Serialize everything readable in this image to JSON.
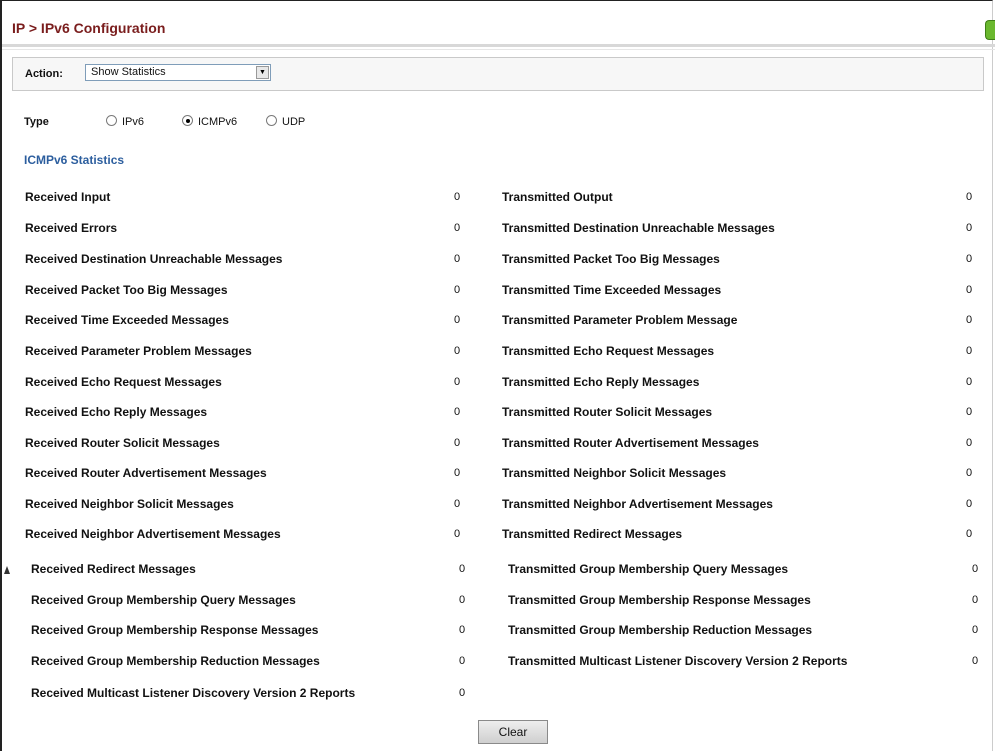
{
  "title": "IP > IPv6 Configuration",
  "action": {
    "label": "Action:",
    "selected": "Show Statistics"
  },
  "type": {
    "label": "Type",
    "options": [
      {
        "label": "IPv6",
        "checked": false
      },
      {
        "label": "ICMPv6",
        "checked": true
      },
      {
        "label": "UDP",
        "checked": false
      }
    ]
  },
  "section_title": "ICMPv6 Statistics",
  "left": [
    {
      "label": "Received Input",
      "value": "0"
    },
    {
      "label": "Received Errors",
      "value": "0"
    },
    {
      "label": "Received Destination Unreachable Messages",
      "value": "0"
    },
    {
      "label": "Received Packet Too Big Messages",
      "value": "0"
    },
    {
      "label": "Received Time Exceeded Messages",
      "value": "0"
    },
    {
      "label": "Received Parameter Problem Messages",
      "value": "0"
    },
    {
      "label": "Received Echo Request Messages",
      "value": "0"
    },
    {
      "label": "Received Echo Reply Messages",
      "value": "0"
    },
    {
      "label": "Received Router Solicit Messages",
      "value": "0"
    },
    {
      "label": "Received Router Advertisement Messages",
      "value": "0"
    },
    {
      "label": "Received Neighbor Solicit Messages",
      "value": "0"
    },
    {
      "label": "Received Neighbor Advertisement Messages",
      "value": "0"
    },
    {
      "label": "Received Redirect Messages",
      "value": "0"
    },
    {
      "label": "Received Group Membership Query Messages",
      "value": "0"
    },
    {
      "label": "Received Group Membership Response Messages",
      "value": "0"
    },
    {
      "label": "Received Group Membership Reduction Messages",
      "value": "0"
    },
    {
      "label": "Received Multicast Listener Discovery Version 2 Reports",
      "value": "0"
    }
  ],
  "right": [
    {
      "label": "Transmitted Output",
      "value": "0"
    },
    {
      "label": "Transmitted Destination Unreachable Messages",
      "value": "0"
    },
    {
      "label": "Transmitted Packet Too Big Messages",
      "value": "0"
    },
    {
      "label": "Transmitted Time Exceeded Messages",
      "value": "0"
    },
    {
      "label": "Transmitted Parameter Problem Message",
      "value": "0"
    },
    {
      "label": "Transmitted Echo Request Messages",
      "value": "0"
    },
    {
      "label": "Transmitted Echo Reply Messages",
      "value": "0"
    },
    {
      "label": "Transmitted Router Solicit Messages",
      "value": "0"
    },
    {
      "label": "Transmitted Router Advertisement Messages",
      "value": "0"
    },
    {
      "label": "Transmitted Neighbor Solicit Messages",
      "value": "0"
    },
    {
      "label": "Transmitted Neighbor Advertisement Messages",
      "value": "0"
    },
    {
      "label": "Transmitted Redirect Messages",
      "value": "0"
    },
    {
      "label": "Transmitted Group Membership Query Messages",
      "value": "0"
    },
    {
      "label": "Transmitted Group Membership Response Messages",
      "value": "0"
    },
    {
      "label": "Transmitted Group Membership Reduction Messages",
      "value": "0"
    },
    {
      "label": "Transmitted Multicast Listener Discovery Version 2 Reports",
      "value": "0"
    }
  ],
  "clear_label": "Clear"
}
